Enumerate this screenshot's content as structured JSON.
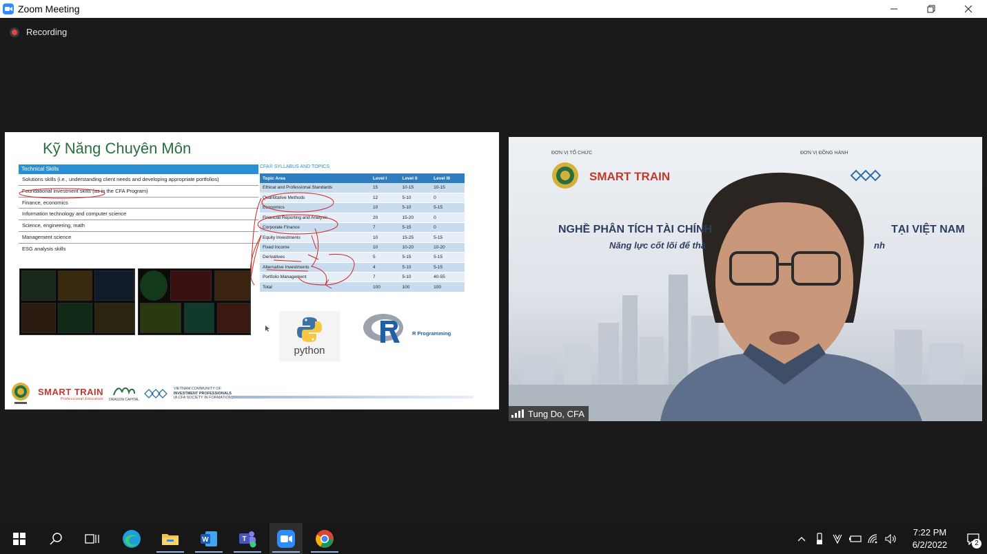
{
  "window": {
    "title": "Zoom Meeting",
    "minimize_icon": "minimize-icon",
    "restore_icon": "restore-icon",
    "close_icon": "close-icon"
  },
  "meeting": {
    "recording_label": "Recording"
  },
  "slide": {
    "title": "Kỹ Năng Chuyên Môn",
    "skills_header": "Technical Skills",
    "skills": [
      "Solutions skills (i.e., understanding client needs and developing appropriate portfolios)",
      "Foundational investment skills (as in the CFA Program)",
      "Finance, economics",
      "Information technology and computer science",
      "Science, engineering, math",
      "Management science",
      "ESG analysis skills"
    ],
    "syllabus_caption": "CFA® SYLLABUS AND TOPICS",
    "syllabus_columns": [
      "Topic Area",
      "Level I",
      "Level II",
      "Level III"
    ],
    "syllabus_rows": [
      [
        "Ethical and Professional Standards",
        "15",
        "10-15",
        "10-15"
      ],
      [
        "Quantitative Methods",
        "12",
        "5-10",
        "0"
      ],
      [
        "Economics",
        "10",
        "5-10",
        "5-15"
      ],
      [
        "Financial Reporting and Analysis",
        "20",
        "15-20",
        "0"
      ],
      [
        "Corporate Finance",
        "7",
        "5-15",
        "0"
      ],
      [
        "Equity Investments",
        "10",
        "15-25",
        "5-15"
      ],
      [
        "Fixed Income",
        "10",
        "10-20",
        "10-20"
      ],
      [
        "Derivatives",
        "5",
        "5-15",
        "5-15"
      ],
      [
        "Alternative Investments",
        "4",
        "5-10",
        "5-15"
      ],
      [
        "Portfolio Management",
        "7",
        "5-10",
        "40-55"
      ],
      [
        "Total",
        "100",
        "100",
        "100"
      ]
    ],
    "python_label": "python",
    "r_label": "R Programming",
    "footer": {
      "smart_train": "SMART TRAIN",
      "smart_train_sub": "Professional Education",
      "dragon_capital": "DRAGON CAPITAL",
      "vcip_line1": "VIETNAM COMMUNITY OF",
      "vcip_line2": "INVESTMENT PROFESSIONALS",
      "vcip_line3": "(A CFA SOCIETY IN FORMATION)"
    }
  },
  "video": {
    "participant_name": "Tung Do, CFA",
    "banner_left": "ĐƠN VỊ TỔ CHỨC",
    "banner_right": "ĐƠN VỊ ĐỒNG HÀNH",
    "banner_headline_left": "NGHỀ PHÂN TÍCH TÀI CHÍNH",
    "banner_headline_right": "TẠI VIỆT NAM",
    "banner_sub_left": "Năng lực cốt lõi để thà",
    "banner_sub_right": "nh",
    "banner_smart_train": "SMART TRAIN"
  },
  "taskbar": {
    "apps": [
      "windows-start-icon",
      "search-icon",
      "task-view-icon",
      "edge-icon",
      "file-explorer-icon",
      "word-icon",
      "teams-icon",
      "zoom-icon",
      "chrome-icon"
    ],
    "time": "7:22 PM",
    "date": "6/2/2022",
    "notification_count": "2"
  }
}
